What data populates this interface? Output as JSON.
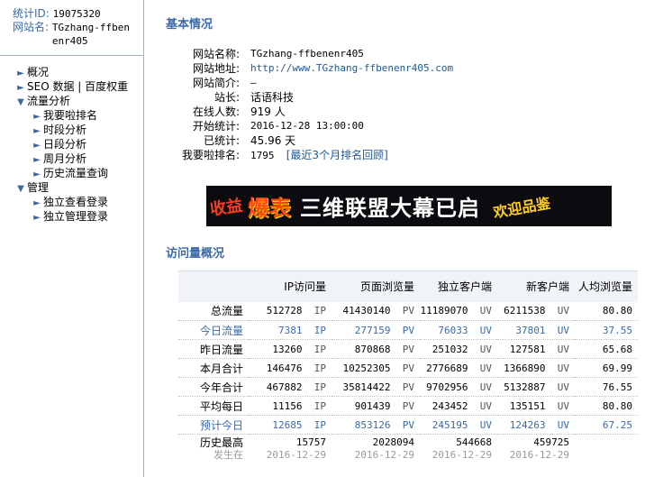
{
  "sidebar": {
    "stat_id_label": "统计ID:",
    "stat_id": "19075320",
    "site_name_label": "网站名:",
    "site_name": "TGzhang-ffbenenr405",
    "menu": [
      {
        "label": "概况",
        "level": 1
      },
      {
        "label": "SEO 数据 | 百度权重",
        "level": 1
      },
      {
        "label": "流量分析",
        "level": 1,
        "expanded": true
      },
      {
        "label": "我要啦排名",
        "level": 2
      },
      {
        "label": "时段分析",
        "level": 2
      },
      {
        "label": "日段分析",
        "level": 2
      },
      {
        "label": "周月分析",
        "level": 2
      },
      {
        "label": "历史流量查询",
        "level": 2
      },
      {
        "label": "管理",
        "level": 1,
        "expanded": true
      },
      {
        "label": "独立查看登录",
        "level": 2
      },
      {
        "label": "独立管理登录",
        "level": 2
      }
    ]
  },
  "basic": {
    "title": "基本情况",
    "rows": [
      {
        "k": "网站名称:",
        "v": "TGzhang-ffbenenr405"
      },
      {
        "k": "网站地址:",
        "link": "http://www.TGzhang-ffbenenr405.com"
      },
      {
        "k": "网站简介:",
        "v": "–"
      },
      {
        "k": "站长:",
        "v": "话语科技"
      },
      {
        "k": "在线人数:",
        "v": "919 人"
      },
      {
        "k": "开始统计:",
        "v": "2016-12-28 13:00:00"
      },
      {
        "k": "已统计:",
        "v": "45.96 天"
      },
      {
        "k": "我要啦排名:",
        "v": "1795",
        "link": "[最近3个月排名回顾]"
      }
    ]
  },
  "banner": {
    "left": "收益",
    "main1": "爆表",
    "main2": "三维联盟大幕已启",
    "right": "欢迎品鉴"
  },
  "visit": {
    "title": "访问量概况",
    "headers": [
      "",
      "IP访问量",
      "页面浏览量",
      "独立客户端",
      "新客户端",
      "人均浏览量"
    ],
    "rows": [
      {
        "label": "总流量",
        "ip": "512728",
        "pv": "41430140",
        "uv": "11189070",
        "nuv": "6211538",
        "avg": "80.80",
        "blue": false
      },
      {
        "label": "今日流量",
        "ip": "7381",
        "pv": "277159",
        "uv": "76033",
        "nuv": "37801",
        "avg": "37.55",
        "blue": true
      },
      {
        "label": "昨日流量",
        "ip": "13260",
        "pv": "870868",
        "uv": "251032",
        "nuv": "127581",
        "avg": "65.68",
        "blue": false
      },
      {
        "label": "本月合计",
        "ip": "146476",
        "pv": "10252305",
        "uv": "2776689",
        "nuv": "1366890",
        "avg": "69.99",
        "blue": false
      },
      {
        "label": "今年合计",
        "ip": "467882",
        "pv": "35814422",
        "uv": "9702956",
        "nuv": "5132887",
        "avg": "76.55",
        "blue": false
      },
      {
        "label": "平均每日",
        "ip": "11156",
        "pv": "901439",
        "uv": "243452",
        "nuv": "135151",
        "avg": "80.80",
        "blue": false
      },
      {
        "label": "预计今日",
        "ip": "12685",
        "pv": "853126",
        "uv": "245195",
        "nuv": "124263",
        "avg": "67.25",
        "blue": true
      }
    ],
    "units": {
      "ip": "IP",
      "pv": "PV",
      "uv": "UV"
    },
    "history": {
      "label": "历史最高",
      "sub_label": "发生在",
      "ip": "15757",
      "pv": "2028094",
      "uv": "544668",
      "nuv": "459725",
      "ip_date": "2016-12-29",
      "pv_date": "2016-12-29",
      "uv_date": "2016-12-29",
      "nuv_date": "2016-12-29"
    }
  },
  "colors": {
    "accent": "#3a6aa8",
    "link": "#1a5aa0",
    "border": "#9db3c8"
  }
}
